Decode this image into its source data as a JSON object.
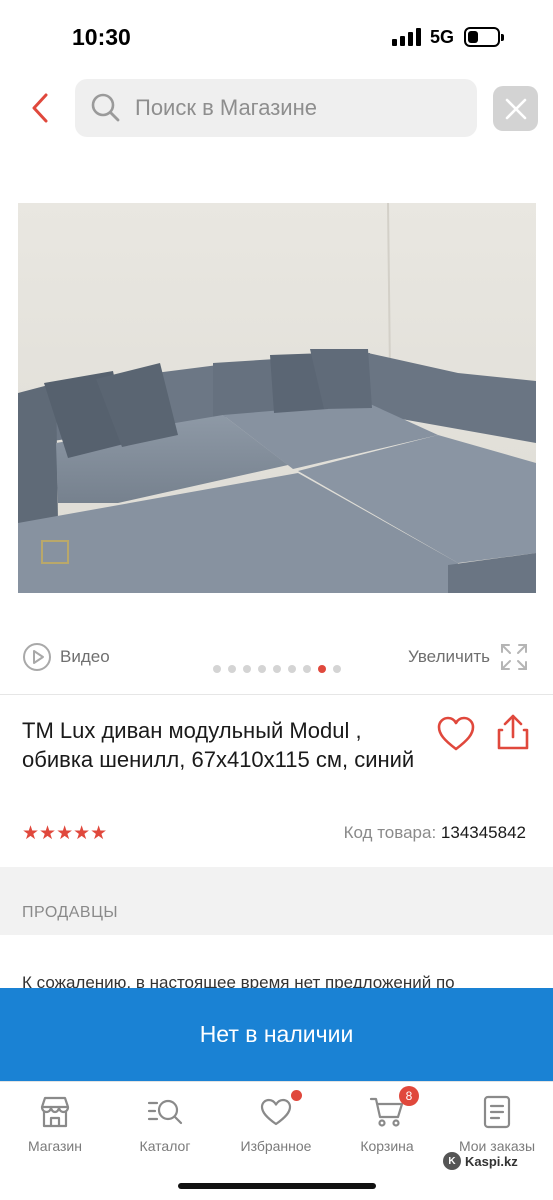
{
  "status_bar": {
    "time": "10:30",
    "network": "5G",
    "battery_level": 0.35
  },
  "search": {
    "placeholder": "Поиск в Магазине",
    "back_icon": "chevron-left-icon",
    "search_icon": "search-icon",
    "clear_icon": "close-icon"
  },
  "gallery": {
    "video_label": "Видео",
    "zoom_label": "Увеличить",
    "dots_total": 9,
    "active_dot": 8
  },
  "product": {
    "title": "TM Lux диван модульный Modul , обивка шенилл, 67x410x115 см, синий",
    "rating": 5,
    "stars": "★★★★★",
    "sku_label": "Код товара:",
    "sku_value": "134345842"
  },
  "sellers": {
    "title": "ПРОДАВЦЫ",
    "message": "К сожалению, в настоящее время нет предложений по"
  },
  "cta": {
    "label": "Нет в наличии"
  },
  "nav": {
    "items": [
      {
        "label": "Магазин",
        "icon": "store-icon"
      },
      {
        "label": "Каталог",
        "icon": "catalog-icon"
      },
      {
        "label": "Избранное",
        "icon": "heart-icon",
        "dot": true
      },
      {
        "label": "Корзина",
        "icon": "cart-icon",
        "badge": "8"
      },
      {
        "label": "Мои заказы",
        "icon": "orders-icon"
      }
    ]
  },
  "watermark": "Kaspi.kz",
  "colors": {
    "accent_red": "#e0483c",
    "primary_blue": "#1a82d4"
  }
}
